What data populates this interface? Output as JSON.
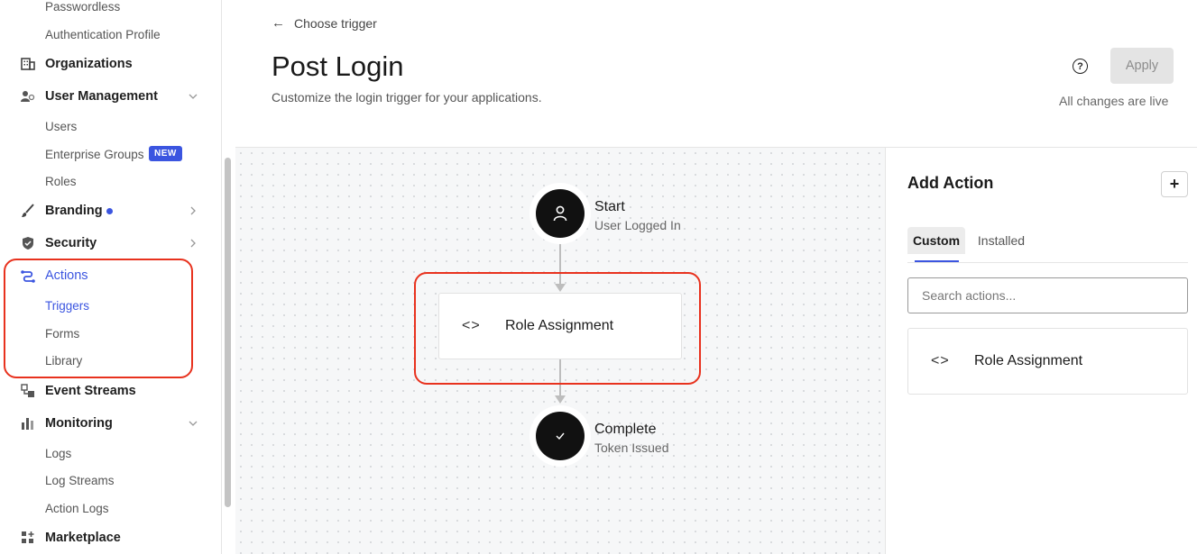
{
  "sidebar": {
    "passwordless": "Passwordless",
    "auth_profile": "Authentication Profile",
    "organizations": "Organizations",
    "user_management": "User Management",
    "users": "Users",
    "enterprise_groups": "Enterprise Groups",
    "new_badge": "NEW",
    "roles": "Roles",
    "branding": "Branding",
    "security": "Security",
    "actions": "Actions",
    "triggers": "Triggers",
    "forms": "Forms",
    "library": "Library",
    "event_streams": "Event Streams",
    "monitoring": "Monitoring",
    "logs": "Logs",
    "log_streams": "Log Streams",
    "action_logs": "Action Logs",
    "marketplace": "Marketplace"
  },
  "header": {
    "back_label": "Choose trigger",
    "title": "Post Login",
    "subtitle": "Customize the login trigger for your applications.",
    "help_glyph": "?",
    "apply_label": "Apply",
    "status": "All changes are live"
  },
  "flow": {
    "start_title": "Start",
    "start_sub": "User Logged In",
    "action_label": "Role Assignment",
    "complete_title": "Complete",
    "complete_sub": "Token Issued"
  },
  "panel": {
    "title": "Add Action",
    "add_glyph": "+",
    "tab_custom": "Custom",
    "tab_installed": "Installed",
    "search_placeholder": "Search actions...",
    "list_item": "Role Assignment"
  },
  "icons": {
    "code": "<>",
    "back_arrow": "←"
  },
  "colors": {
    "accent": "#3b55e0",
    "highlight": "#e8321e",
    "node": "#111111"
  }
}
